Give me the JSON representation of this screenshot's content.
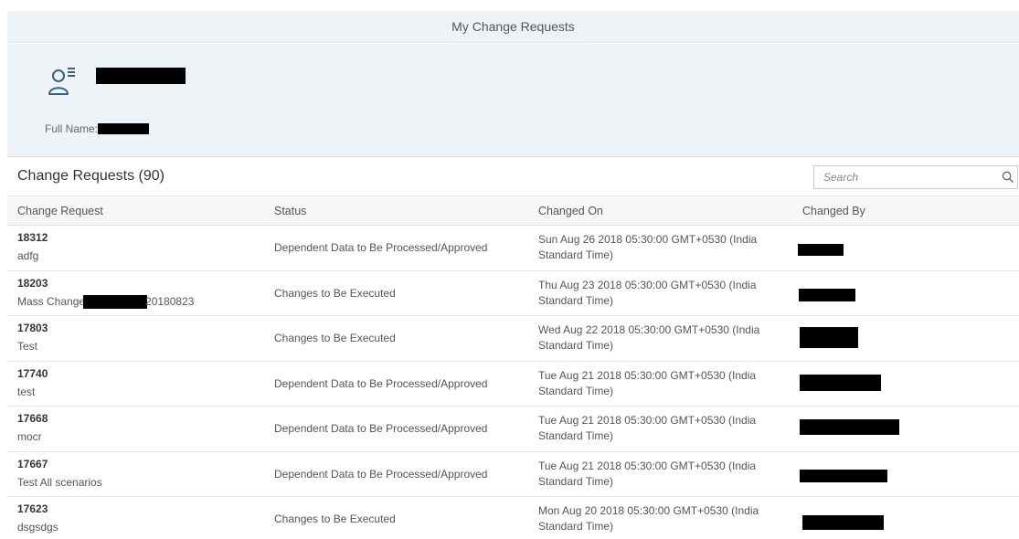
{
  "page": {
    "title": "My Change Requests"
  },
  "user": {
    "full_name_label": "Full Name:"
  },
  "list": {
    "title": "Change Requests (90)",
    "search_placeholder": "Search",
    "columns": [
      "Change Request",
      "Status",
      "Changed On",
      "Changed By"
    ],
    "rows": [
      {
        "id": "18312",
        "description": "adfg",
        "status": "Dependent Data to Be Processed/Approved",
        "changed_on": "Sun Aug 26 2018 05:30:00 GMT+0530 (India Standard Time)"
      },
      {
        "id": "18203",
        "description_prefix": "Mass Change",
        "description_suffix": "20180823",
        "status": "Changes to Be Executed",
        "changed_on": "Thu Aug 23 2018 05:30:00 GMT+0530 (India Standard Time)"
      },
      {
        "id": "17803",
        "description": "Test",
        "status": "Changes to Be Executed",
        "changed_on": "Wed Aug 22 2018 05:30:00 GMT+0530 (India Standard Time)"
      },
      {
        "id": "17740",
        "description": "test",
        "status": "Dependent Data to Be Processed/Approved",
        "changed_on": "Tue Aug 21 2018 05:30:00 GMT+0530 (India Standard Time)"
      },
      {
        "id": "17668",
        "description": "mocr",
        "status": "Dependent Data to Be Processed/Approved",
        "changed_on": "Tue Aug 21 2018 05:30:00 GMT+0530 (India Standard Time)"
      },
      {
        "id": "17667",
        "description": "Test All scenarios",
        "status": "Dependent Data to Be Processed/Approved",
        "changed_on": "Tue Aug 21 2018 05:30:00 GMT+0530 (India Standard Time)"
      },
      {
        "id": "17623",
        "description": "dsgsdgs",
        "status": "Changes to Be Executed",
        "changed_on": "Mon Aug 20 2018 05:30:00 GMT+0530 (India Standard Time)"
      }
    ]
  },
  "icons": {
    "user": "user-list-icon",
    "search": "search-icon"
  },
  "colors": {
    "header_bg": "#eef3f8",
    "icon_blue": "#346187",
    "border": "#e5e5e5"
  }
}
